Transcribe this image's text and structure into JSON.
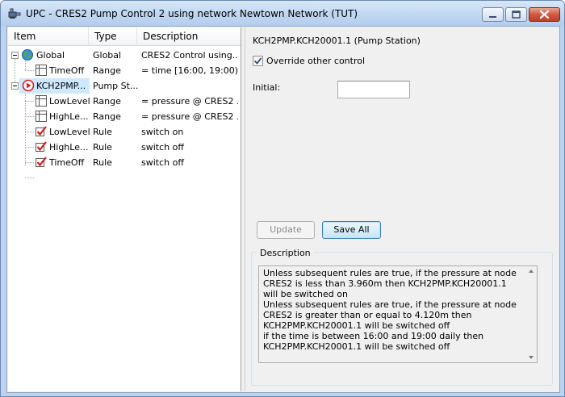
{
  "window": {
    "title": "UPC - CRES2 Pump Control 2  using network Newtown Network (TUT)",
    "icon": "pump-control-app-icon",
    "controls": [
      "minimize-icon",
      "maximize-icon",
      "close-icon"
    ]
  },
  "tree": {
    "columns": [
      "Item",
      "Type",
      "Description"
    ],
    "rows": [
      {
        "name": "Global",
        "type": "Global",
        "description": "CRES2 Control using...",
        "icon": "globe-icon",
        "expander": "minus",
        "level": 0
      },
      {
        "name": "TimeOff",
        "type": "Range",
        "description": "= time [16:00, 19:00) ...",
        "icon": "range-grid-icon",
        "level": 1
      },
      {
        "name": "KCH2PMP...",
        "type": "Pump St...",
        "description": "",
        "icon": "pump-station-icon",
        "expander": "minus",
        "level": 0,
        "selected": true
      },
      {
        "name": "LowLevel",
        "type": "Range",
        "description": "= pressure @ CRES2 ...",
        "icon": "range-grid-icon",
        "level": 1
      },
      {
        "name": "HighLe...",
        "type": "Range",
        "description": "= pressure @ CRES2 ...",
        "icon": "range-grid-icon",
        "level": 1
      },
      {
        "name": "LowLevel",
        "type": "Rule",
        "description": "switch on",
        "icon": "rule-check-icon",
        "level": 1
      },
      {
        "name": "HighLe...",
        "type": "Rule",
        "description": "switch off",
        "icon": "rule-check-icon",
        "level": 1
      },
      {
        "name": "TimeOff",
        "type": "Rule",
        "description": "switch off",
        "icon": "rule-check-icon",
        "level": 1
      }
    ]
  },
  "detail": {
    "heading": "KCH2PMP.KCH20001.1 (Pump Station)",
    "override_label": "Override other control",
    "override_checked": true,
    "initial_label": "Initial:",
    "initial_value": "",
    "update_label": "Update",
    "update_enabled": false,
    "save_all_label": "Save All",
    "description_title": "Description",
    "description_text": "Unless subsequent rules are true, if the pressure at node CRES2 is less than 3.960m then KCH2PMP.KCH20001.1 will be switched on\nUnless subsequent rules are true, if the pressure at node CRES2 is greater than or equal to 4.120m then KCH2PMP.KCH20001.1 will be switched off\nif the time is between 16:00 and 19:00 daily then KCH2PMP.KCH20001.1 will be switched off"
  },
  "colors": {
    "title_bar": "#c2d8f2",
    "close_button": "#c13f24",
    "selection": "#cde8ff",
    "default_button_border": "#3c7fb1"
  }
}
